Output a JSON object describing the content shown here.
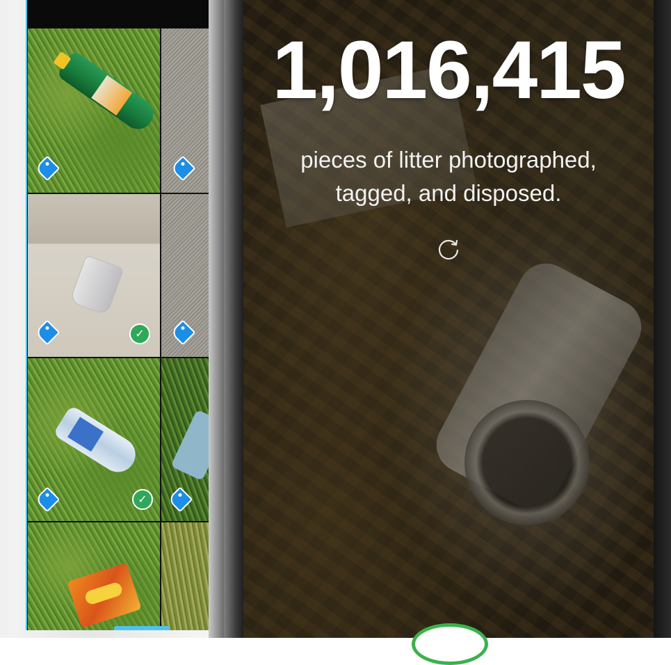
{
  "counter": {
    "value": "1,016,415",
    "caption_line1": "pieces of litter photographed,",
    "caption_line2": "tagged, and disposed."
  },
  "icons": {
    "refresh": "refresh-icon",
    "tag": "tag-icon",
    "check": "check-icon"
  },
  "colors": {
    "tag_blue": "#1c8ee8",
    "check_green": "#2fa85a",
    "accent_cyan": "#4dc3ef",
    "action_green": "#3bb24b"
  },
  "photo_grid": [
    {
      "tagged": true,
      "disposed": false
    },
    {
      "tagged": true,
      "disposed": false
    },
    {
      "tagged": true,
      "disposed": true
    },
    {
      "tagged": true,
      "disposed": false
    },
    {
      "tagged": true,
      "disposed": true
    },
    {
      "tagged": true,
      "disposed": false
    },
    {
      "tagged": false,
      "disposed": false
    },
    {
      "tagged": false,
      "disposed": false
    }
  ]
}
